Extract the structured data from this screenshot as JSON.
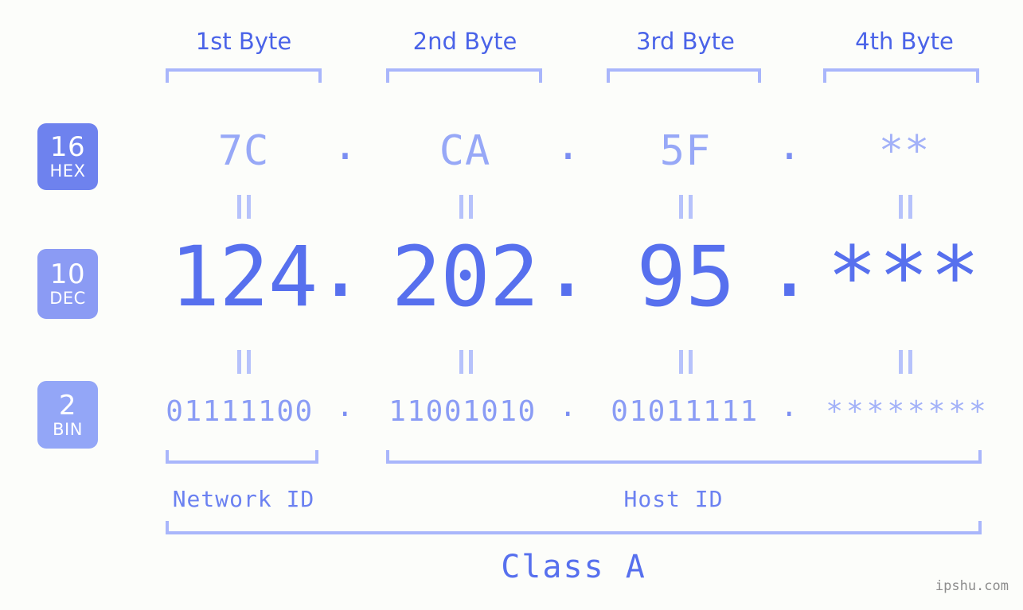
{
  "page": {
    "background_color": "#fcfdfa",
    "accent_color": "#5770ee",
    "accent_light_color": "#a2b1f8",
    "bracket_color": "#a9b6fb"
  },
  "headers": {
    "byte1": "1st Byte",
    "byte2": "2nd Byte",
    "byte3": "3rd Byte",
    "byte4": "4th Byte"
  },
  "bases": {
    "hex": {
      "radix": "16",
      "name": "HEX",
      "badge_color": "#6e82ee"
    },
    "dec": {
      "radix": "10",
      "name": "DEC",
      "badge_color": "#8b9bf4"
    },
    "bin": {
      "radix": "2",
      "name": "BIN",
      "badge_color": "#93a6f7"
    }
  },
  "rows": {
    "hex": {
      "values": [
        "7C",
        "CA",
        "5F",
        "**"
      ],
      "separators": [
        ".",
        ".",
        "."
      ]
    },
    "dec": {
      "values": [
        "124",
        "202",
        "95",
        "***"
      ],
      "separators": [
        ".",
        ".",
        "."
      ]
    },
    "bin": {
      "values": [
        "01111100",
        "11001010",
        "01011111",
        "********"
      ],
      "separators": [
        ".",
        ".",
        "."
      ]
    }
  },
  "equals_symbol": "=",
  "sections": {
    "network_id": "Network ID",
    "host_id": "Host ID",
    "class": "Class A"
  },
  "watermark": "ipshu.com"
}
